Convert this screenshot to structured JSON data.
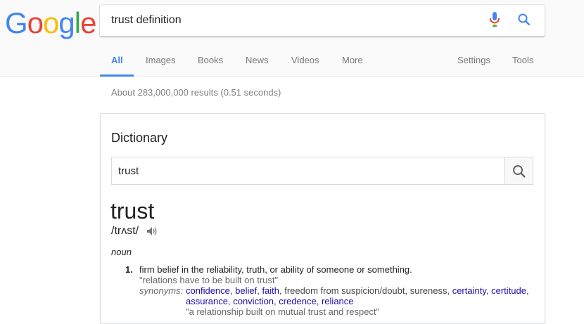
{
  "logo": {
    "letters": [
      "G",
      "o",
      "o",
      "g",
      "l",
      "e"
    ],
    "colors": [
      "#4285f4",
      "#ea4335",
      "#fbbc05",
      "#4285f4",
      "#34a853",
      "#ea4335"
    ]
  },
  "search": {
    "query": "trust definition"
  },
  "tabs": {
    "left": [
      {
        "label": "All",
        "active": true
      },
      {
        "label": "Images"
      },
      {
        "label": "Books"
      },
      {
        "label": "News"
      },
      {
        "label": "Videos"
      },
      {
        "label": "More"
      }
    ],
    "right": [
      {
        "label": "Settings"
      },
      {
        "label": "Tools"
      }
    ]
  },
  "stats": "About 283,000,000 results (0.51 seconds)",
  "dictionary": {
    "title": "Dictionary",
    "input_value": "trust",
    "word": "trust",
    "phonetic": "/trʌst/",
    "part_of_speech": "noun",
    "definitions": [
      {
        "number": "1.",
        "text": "firm belief in the reliability, truth, or ability of someone or something.",
        "example": "\"relations have to be built on trust\"",
        "synonyms_label": "synonyms:",
        "synonyms_line1": [
          {
            "text": "confidence",
            "link": true
          },
          {
            "text": ", ",
            "link": false
          },
          {
            "text": "belief",
            "link": true
          },
          {
            "text": ", ",
            "link": false
          },
          {
            "text": "faith",
            "link": true
          },
          {
            "text": ", freedom from suspicion/doubt, sureness, ",
            "link": false
          },
          {
            "text": "certainty",
            "link": true
          },
          {
            "text": ", ",
            "link": false
          },
          {
            "text": "certitude",
            "link": true
          },
          {
            "text": ",",
            "link": false
          }
        ],
        "synonyms_line2": [
          {
            "text": "assurance",
            "link": true
          },
          {
            "text": ", ",
            "link": false
          },
          {
            "text": "conviction",
            "link": true
          },
          {
            "text": ", ",
            "link": false
          },
          {
            "text": "credence",
            "link": true
          },
          {
            "text": ", ",
            "link": false
          },
          {
            "text": "reliance",
            "link": true
          }
        ],
        "synonym_example": "\"a relationship built on mutual trust and respect\""
      }
    ]
  },
  "colors": {
    "accent": "#4285f4",
    "link": "#1a0dab",
    "muted": "#808080"
  }
}
